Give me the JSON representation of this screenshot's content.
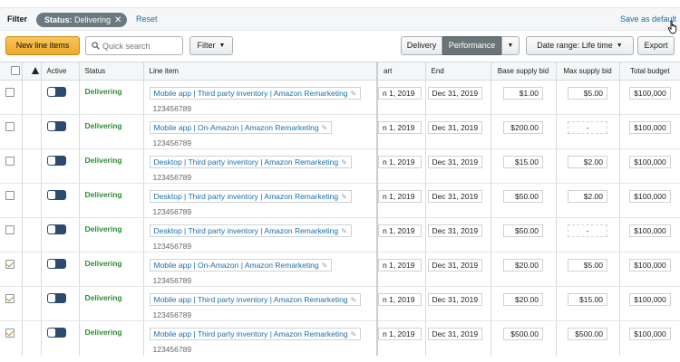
{
  "filter": {
    "label": "Filter",
    "chip_key": "Status:",
    "chip_value": " Delivering",
    "chip_close": "✕",
    "reset": "Reset",
    "save_default": "Save as default"
  },
  "toolbar": {
    "new_line_items": "New line items",
    "search_placeholder": "Quick search",
    "filter_button": "Filter",
    "delivery": "Delivery",
    "performance": "Performance",
    "date_range": "Date range: Life time",
    "export": "Export"
  },
  "columns": {
    "active": "Active",
    "status": "Status",
    "line_item": "Line item",
    "start": "art",
    "end": "End",
    "base_bid": "Base supply bid",
    "max_bid": "Max supply bid",
    "total_budget": "Total budget"
  },
  "rows": [
    {
      "checked": false,
      "status": "Delivering",
      "name": "Mobile app | Third party inventory | Amazon Remarketing",
      "id": "123456789",
      "start": "n 1, 2019",
      "end": "Dec 31, 2019",
      "base": "$1.00",
      "max": "$5.00",
      "budget": "$100,000"
    },
    {
      "checked": false,
      "status": "Delivering",
      "name": "Mobile app | On-Amazon | Amazon Remarketing",
      "id": "123456789",
      "start": "n 1, 2019",
      "end": "Dec 31, 2019",
      "base": "$200.00",
      "max": "-",
      "budget": "$100,000"
    },
    {
      "checked": false,
      "status": "Delivering",
      "name": "Desktop | Third party inventory | Amazon Remarketing",
      "id": "123456789",
      "start": "n 1, 2019",
      "end": "Dec 31, 2019",
      "base": "$15.00",
      "max": "$2.00",
      "budget": "$100,000"
    },
    {
      "checked": false,
      "status": "Delivering",
      "name": "Desktop | Third party inventory | Amazon Remarketing",
      "id": "123456789",
      "start": "n 1, 2019",
      "end": "Dec 31, 2019",
      "base": "$50.00",
      "max": "$2.00",
      "budget": "$100,000"
    },
    {
      "checked": false,
      "status": "Delivering",
      "name": "Desktop | Third party inventory | Amazon Remarketing",
      "id": "123456789",
      "start": "n 1, 2019",
      "end": "Dec 31, 2019",
      "base": "$50.00",
      "max": "-",
      "budget": "$100,000"
    },
    {
      "checked": true,
      "status": "Delivering",
      "name": "Mobile app | On-Amazon | Amazon Remarketing",
      "id": "123456789",
      "start": "n 1, 2019",
      "end": "Dec 31, 2019",
      "base": "$20.00",
      "max": "$5.00",
      "budget": "$100,000"
    },
    {
      "checked": true,
      "status": "Delivering",
      "name": "Mobile app | Third party inventory | Amazon Remarketing",
      "id": "123456789",
      "start": "n 1, 2019",
      "end": "Dec 31, 2019",
      "base": "$20.00",
      "max": "$15.00",
      "budget": "$100,000"
    },
    {
      "checked": true,
      "status": "Delivering",
      "name": "Mobile app | Third party inventory | Amazon Remarketing",
      "id": "123456789",
      "start": "n 1, 2019",
      "end": "Dec 31, 2019",
      "base": "$500.00",
      "max": "$500.00",
      "budget": "$100,000"
    }
  ]
}
